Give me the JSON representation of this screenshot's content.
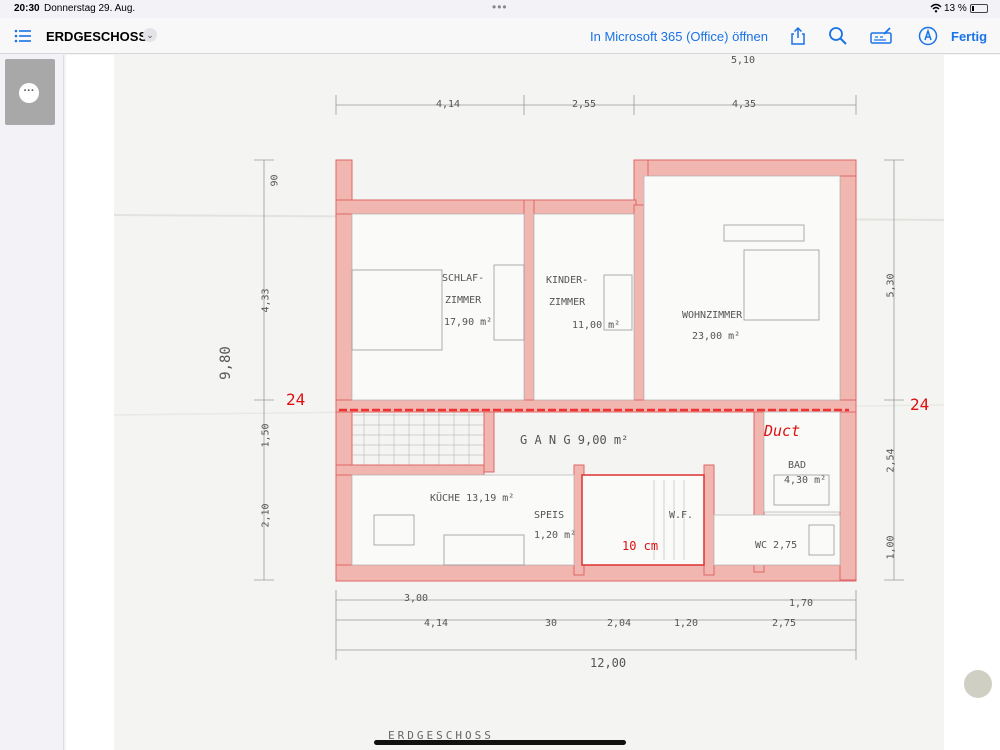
{
  "status": {
    "time": "20:30",
    "date": "Donnerstag 29. Aug.",
    "battery": "13 %"
  },
  "toolbar": {
    "title": "ERDGESCHOSS",
    "open_in_office": "In Microsoft 365 (Office) öffnen",
    "done_label": "Fertig",
    "icons": [
      "list-icon",
      "chevron-down-icon",
      "share-icon",
      "search-icon",
      "markup-icon",
      "pen-icon"
    ]
  },
  "plan": {
    "top_dims": [
      "5,10",
      "4,14",
      "2,55",
      "4,35"
    ],
    "side_dims_left": [
      "90",
      "4,33",
      "9,80",
      "1,50",
      "2,10"
    ],
    "side_dims_right": [
      "5,30",
      "2,54",
      "1,00"
    ],
    "bottom_dims_row1": [
      "3,00",
      "1,70"
    ],
    "bottom_dims_row2": [
      "4,14",
      "30",
      "2,04",
      "1,20",
      "2,75"
    ],
    "overall": "12,00",
    "rooms": {
      "schlaf": [
        "SCHLAF-",
        "ZIMMER",
        "17,90 m²"
      ],
      "kinder": [
        "KINDER-",
        "ZIMMER",
        "11,00 m²"
      ],
      "wohn": [
        "WOHNZIMMER",
        "23,00 m²"
      ],
      "gang": "G A N G  9,00 m²",
      "kueche": "KÜCHE 13,19 m²",
      "speis": [
        "SPEIS",
        "1,20 m²"
      ],
      "wf": "W.F.",
      "bad": [
        "BAD",
        "4,30 m²"
      ],
      "wc": "WC 2,75"
    },
    "annotations": {
      "left_24": "24",
      "right_24": "24",
      "red_note": "Duct",
      "stair_mark": "10 cm"
    },
    "footer_label": "ERDGESCHOSS"
  }
}
